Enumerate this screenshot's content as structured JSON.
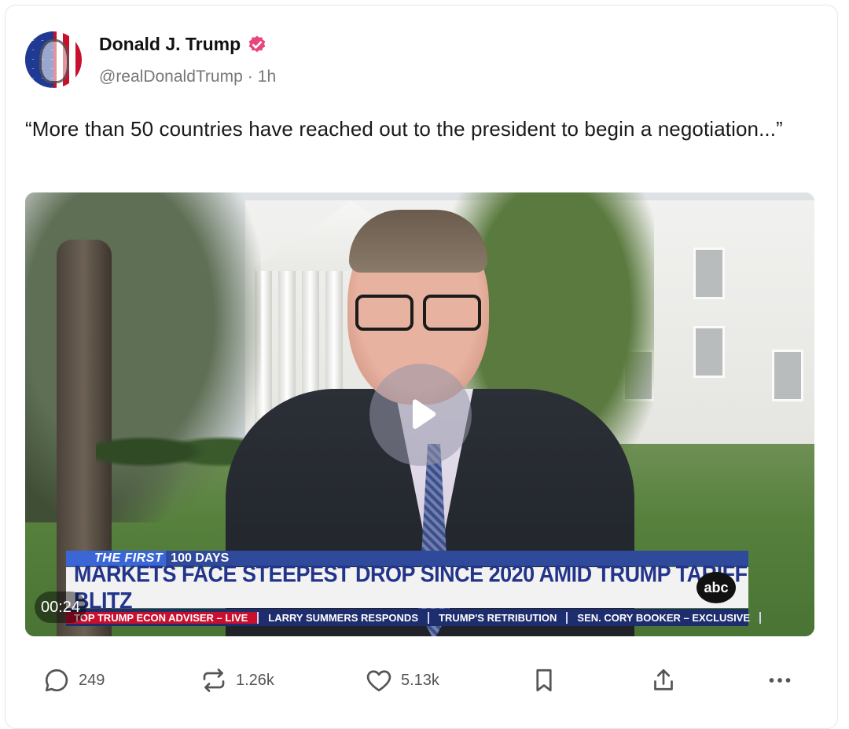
{
  "post": {
    "author_name": "Donald J. Trump",
    "handle": "@realDonaldTrump",
    "separator": "·",
    "time": "1h",
    "text": "“More than 50 countries have reached out to the president to begin a negotiation...”"
  },
  "video": {
    "timestamp": "00:24",
    "ticker_tag": "THE FIRST",
    "ticker_tag_suffix": "100 DAYS",
    "headline": "MARKETS FACE STEEPEST DROP SINCE 2020 AMID TRUMP TARIFF BLITZ",
    "network_logo": "abc",
    "ticker_items": [
      "TOP TRUMP ECON ADVISER – LIVE",
      "LARRY SUMMERS RESPONDS",
      "TRUMP'S RETRIBUTION",
      "SEN. CORY BOOKER – EXCLUSIVE"
    ]
  },
  "actions": {
    "replies": "249",
    "reposts": "1.26k",
    "likes": "5.13k"
  },
  "colors": {
    "verified_badge": "#e8467c",
    "ticker_blue": "#2f4a9a",
    "headline_blue": "#23358a"
  },
  "icons": [
    "comment-icon",
    "repost-icon",
    "heart-icon",
    "bookmark-icon",
    "share-icon",
    "more-icon",
    "verified-icon",
    "play-icon"
  ]
}
